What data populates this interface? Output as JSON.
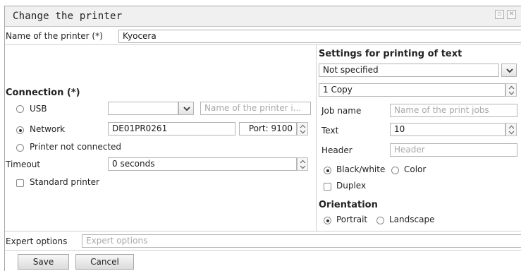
{
  "window": {
    "title": "Change the printer"
  },
  "printer_name": {
    "label": "Name of the printer (*)",
    "value": "Kyocera"
  },
  "connection": {
    "heading": "Connection (*)",
    "usb": {
      "label": "USB",
      "selected": false,
      "dropdown_value": "",
      "name_placeholder": "Name of the printer i..."
    },
    "network": {
      "label": "Network",
      "selected": true,
      "address": "DE01PR0261",
      "port": "Port: 9100"
    },
    "not_connected": {
      "label": "Printer  not connected",
      "selected": false
    },
    "timeout": {
      "label": "Timeout",
      "value": "0 seconds"
    },
    "standard_printer": {
      "label": "Standard printer",
      "checked": false
    }
  },
  "text_settings": {
    "heading": "Settings for printing of text",
    "mode": "Not specified",
    "copies": "1 Copy",
    "job_name": {
      "label": "Job name",
      "placeholder": "Name of the print jobs"
    },
    "text": {
      "label": "Text",
      "value": "10"
    },
    "header": {
      "label": "Header",
      "placeholder": "Header"
    },
    "color_mode": {
      "bw_label": "Black/white",
      "color_label": "Color",
      "selected": "Black/white"
    },
    "duplex": {
      "label": "Duplex",
      "checked": false
    }
  },
  "orientation": {
    "heading": "Orientation",
    "portrait_label": "Portrait",
    "landscape_label": "Landscape",
    "selected": "Portrait"
  },
  "expert": {
    "label": "Expert options",
    "placeholder": "Expert options"
  },
  "buttons": {
    "save": "Save",
    "cancel": "Cancel"
  }
}
